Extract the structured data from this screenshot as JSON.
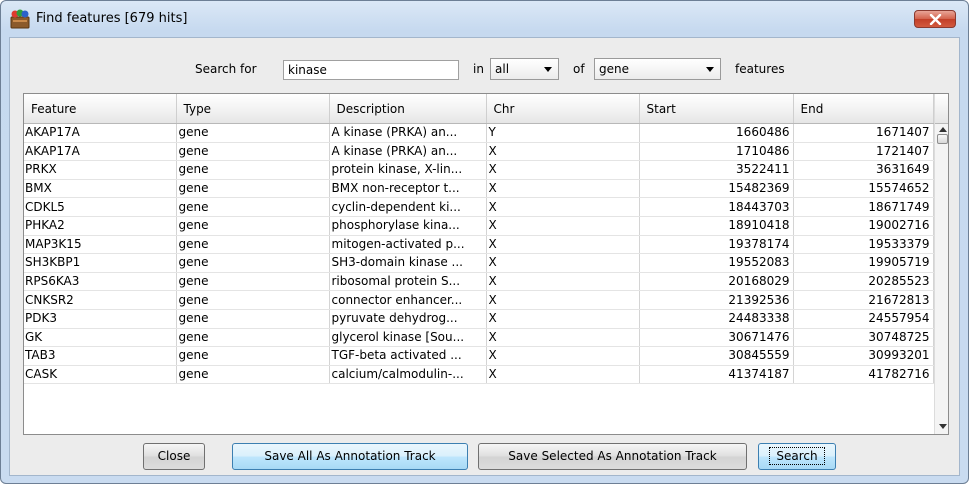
{
  "window": {
    "title": "Find features [679 hits]"
  },
  "search": {
    "search_for_label": "Search for",
    "query": "kinase",
    "in_label": "in",
    "scope": "all",
    "of_label": "of",
    "feature_type": "gene",
    "features_label": "features"
  },
  "table": {
    "columns": [
      "Feature",
      "Type",
      "Description",
      "Chr",
      "Start",
      "End"
    ],
    "rows": [
      [
        "AKAP17A",
        "gene",
        "A kinase (PRKA) an...",
        "Y",
        "1660486",
        "1671407"
      ],
      [
        "AKAP17A",
        "gene",
        "A kinase (PRKA) an...",
        "X",
        "1710486",
        "1721407"
      ],
      [
        "PRKX",
        "gene",
        "protein kinase, X-lin...",
        "X",
        "3522411",
        "3631649"
      ],
      [
        "BMX",
        "gene",
        "BMX non-receptor t...",
        "X",
        "15482369",
        "15574652"
      ],
      [
        "CDKL5",
        "gene",
        "cyclin-dependent ki...",
        "X",
        "18443703",
        "18671749"
      ],
      [
        "PHKA2",
        "gene",
        "phosphorylase kina...",
        "X",
        "18910418",
        "19002716"
      ],
      [
        "MAP3K15",
        "gene",
        "mitogen-activated p...",
        "X",
        "19378174",
        "19533379"
      ],
      [
        "SH3KBP1",
        "gene",
        "SH3-domain kinase ...",
        "X",
        "19552083",
        "19905719"
      ],
      [
        "RPS6KA3",
        "gene",
        "ribosomal protein S...",
        "X",
        "20168029",
        "20285523"
      ],
      [
        "CNKSR2",
        "gene",
        "connector enhancer...",
        "X",
        "21392536",
        "21672813"
      ],
      [
        "PDK3",
        "gene",
        "pyruvate dehydrog...",
        "X",
        "24483338",
        "24557954"
      ],
      [
        "GK",
        "gene",
        "glycerol kinase [Sou...",
        "X",
        "30671476",
        "30748725"
      ],
      [
        "TAB3",
        "gene",
        "TGF-beta activated ...",
        "X",
        "30845559",
        "30993201"
      ],
      [
        "CASK",
        "gene",
        "calcium/calmodulin-...",
        "X",
        "41374187",
        "41782716"
      ]
    ]
  },
  "buttons": {
    "close": "Close",
    "save_all": "Save All As Annotation Track",
    "save_selected": "Save Selected As Annotation Track",
    "search": "Search"
  },
  "colors": {
    "title_bar": "#c6d9ef",
    "close_button": "#c23f28",
    "hot_button": "#bee6fd"
  }
}
